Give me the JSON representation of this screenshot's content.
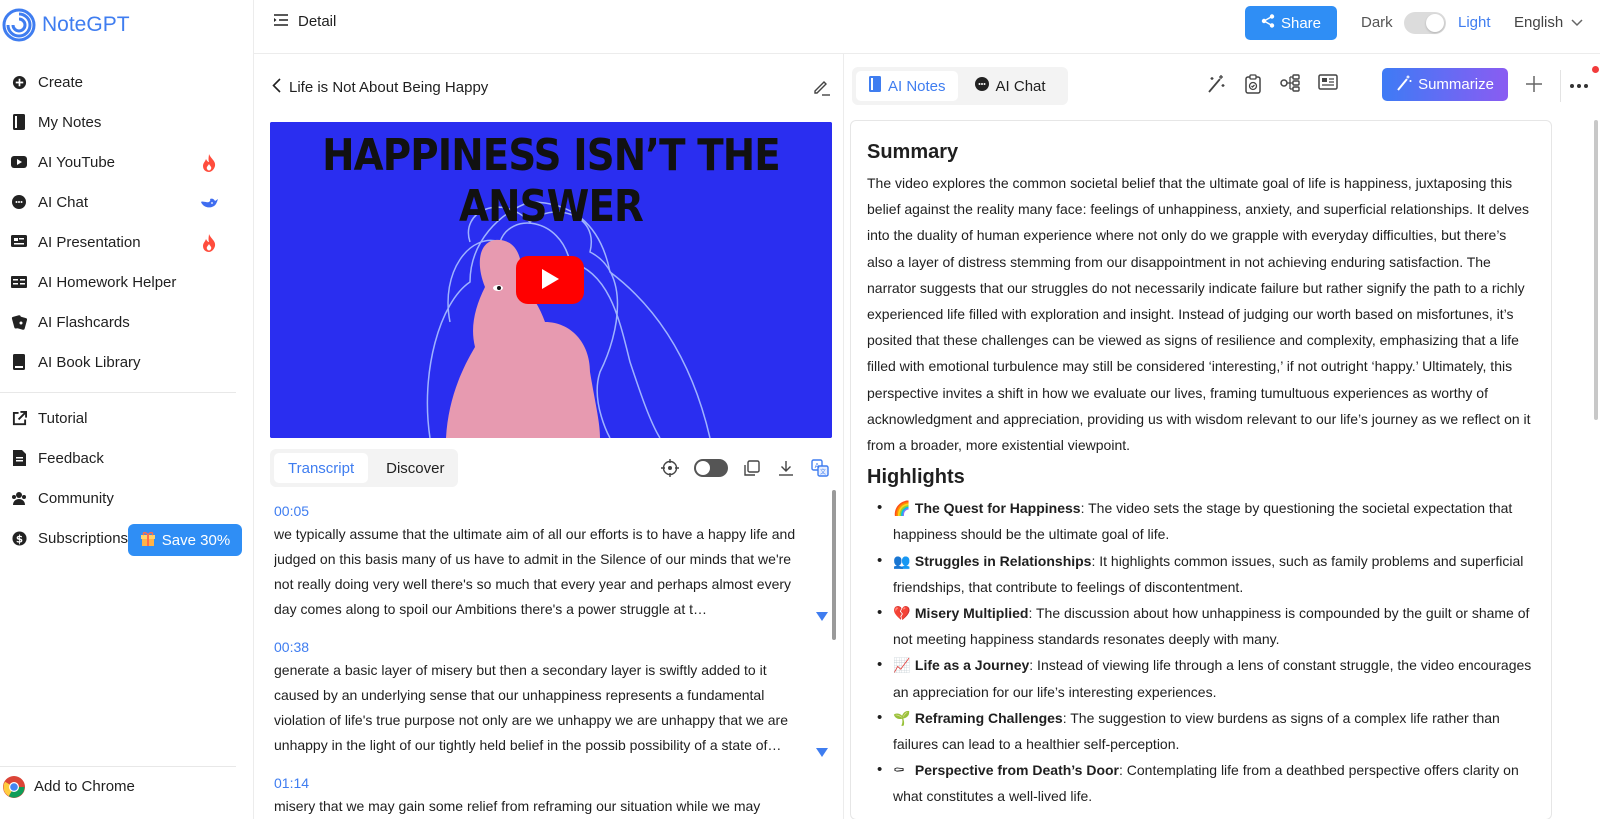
{
  "app": {
    "name": "NoteGPT"
  },
  "sidebar": {
    "items": [
      {
        "label": "Create",
        "icon": "plus-circle-icon"
      },
      {
        "label": "My Notes",
        "icon": "notebook-icon"
      },
      {
        "label": "AI YouTube",
        "icon": "youtube-icon",
        "badge": "fire-icon"
      },
      {
        "label": "AI Chat",
        "icon": "chat-icon",
        "badge": "whale-icon"
      },
      {
        "label": "AI Presentation",
        "icon": "presentation-icon",
        "badge": "fire-icon"
      },
      {
        "label": "AI Homework Helper",
        "icon": "homework-icon"
      },
      {
        "label": "AI Flashcards",
        "icon": "flashcards-icon"
      },
      {
        "label": "AI Book Library",
        "icon": "book-icon"
      }
    ],
    "secondary": [
      {
        "label": "Tutorial",
        "icon": "external-link-icon"
      },
      {
        "label": "Feedback",
        "icon": "document-icon"
      },
      {
        "label": "Community",
        "icon": "community-icon"
      },
      {
        "label": "Subscriptions",
        "icon": "dollar-icon"
      }
    ],
    "save_label": "Save 30%",
    "add_to_chrome": "Add to Chrome"
  },
  "topbar": {
    "title": "Detail",
    "share_label": "Share",
    "dark_label": "Dark",
    "light_label": "Light",
    "language": "English",
    "theme": "light"
  },
  "video": {
    "title": "Life is Not About Being Happy",
    "thumbnail_text": "HAPPINESS ISN’T THE ANSWER",
    "colors": {
      "background": "#2a2ef0",
      "figure": "#e79ab0",
      "play": "#ff0000"
    }
  },
  "transcript_tabs": [
    "Transcript",
    "Discover"
  ],
  "transcript": [
    {
      "time": "00:05",
      "text": "we typically assume that the ultimate aim of all our efforts is to have a happy life and judged on this basis many of us have to admit in the Silence of our minds that we're not really doing very well there's so much that every year and perhaps almost every day comes along to spoil our Ambitions there's a power struggle at t…"
    },
    {
      "time": "00:38",
      "text": "generate a basic layer of misery but then a secondary layer is swiftly added to it caused by an underlying sense that our unhappiness represents a fundamental violation of life's true purpose not only are we unhappy we are unhappy that we are unhappy in the light of our tightly held belief in the possib possibility of a state of…"
    },
    {
      "time": "01:14",
      "text": "misery that we may gain some relief from reframing our situation while we may"
    }
  ],
  "right": {
    "tabs": [
      "AI Notes",
      "AI Chat"
    ],
    "summarize_label": "Summarize",
    "summary_heading": "Summary",
    "summary": "The video explores the common societal belief that the ultimate goal of life is happiness, juxtaposing this belief against the reality many face: feelings of unhappiness, anxiety, and superficial relationships. It delves into the duality of human experience where not only do we grapple with everyday difficulties, but there’s also a layer of distress stemming from our disappointment in not achieving enduring satisfaction. The narrator suggests that our struggles do not necessarily indicate failure but rather signify the path to a richly experienced life filled with exploration and insight. Instead of judging our worth based on misfortunes, it’s posited that these challenges can be viewed as signs of resilience and complexity, emphasizing that a life filled with emotional turbulence may still be considered ‘interesting,’ if not outright ‘happy.’ Ultimately, this perspective invites a shift in how we evaluate our lives, framing tumultuous experiences as worthy of acknowledgment and appreciation, providing us with wisdom relevant to our life’s journey as we reflect on it from a broader, more existential viewpoint.",
    "highlights_heading": "Highlights",
    "highlights": [
      {
        "emoji": "🌈",
        "title": "The Quest for Happiness",
        "text": ": The video sets the stage by questioning the societal expectation that happiness should be the ultimate goal of life."
      },
      {
        "emoji": "👥",
        "title": "Struggles in Relationships",
        "text": ": It highlights common issues, such as family problems and superficial friendships, that contribute to feelings of discontentment."
      },
      {
        "emoji": "💔",
        "title": "Misery Multiplied",
        "text": ": The discussion about how unhappiness is compounded by the guilt or shame of not meeting happiness standards resonates deeply with many."
      },
      {
        "emoji": "📈",
        "title": "Life as a Journey",
        "text": ": Instead of viewing life through a lens of constant struggle, the video encourages an appreciation for our life’s interesting experiences."
      },
      {
        "emoji": "🌱",
        "title": "Reframing Challenges",
        "text": ": The suggestion to view burdens as signs of a complex life rather than failures can lead to a healthier self-perception."
      },
      {
        "emoji": "⚰",
        "title": "Perspective from Death’s Door",
        "text": ": Contemplating life from a deathbed perspective offers clarity on what constitutes a well-lived life."
      }
    ]
  }
}
